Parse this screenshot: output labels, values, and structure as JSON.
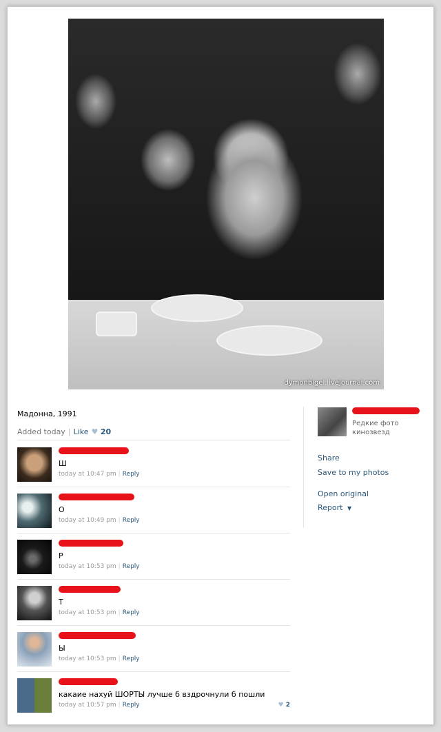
{
  "photo": {
    "watermark": "dymonbigel.livejournal.com"
  },
  "caption": "Мадонна, 1991",
  "meta": {
    "added": "Added today",
    "like_label": "Like",
    "like_count": "20"
  },
  "comments": [
    {
      "text": "Ш",
      "time": "today at 10:47 pm",
      "reply": "Reply",
      "name_bar_w": 102
    },
    {
      "text": "О",
      "time": "today at 10:49 pm",
      "reply": "Reply",
      "name_bar_w": 110
    },
    {
      "text": "Р",
      "time": "today at 10:53 pm",
      "reply": "Reply",
      "name_bar_w": 94
    },
    {
      "text": "Т",
      "time": "today at 10:53 pm",
      "reply": "Reply",
      "name_bar_w": 90
    },
    {
      "text": "Ы",
      "time": "today at 10:53 pm",
      "reply": "Reply",
      "name_bar_w": 112
    },
    {
      "text": "какаие нахуй ШОРТЫ лучше б вздрочнули б пошли",
      "time": "today at 10:57 pm",
      "reply": "Reply",
      "likes": "2",
      "name_bar_w": 86
    }
  ],
  "sidebar": {
    "album_title": "Редкие фото кинозвезд",
    "share": "Share",
    "save": "Save to my photos",
    "open_original": "Open original",
    "report": "Report"
  },
  "colors": {
    "link": "#2b587a",
    "redact": "#e8131a",
    "muted": "#999999"
  }
}
